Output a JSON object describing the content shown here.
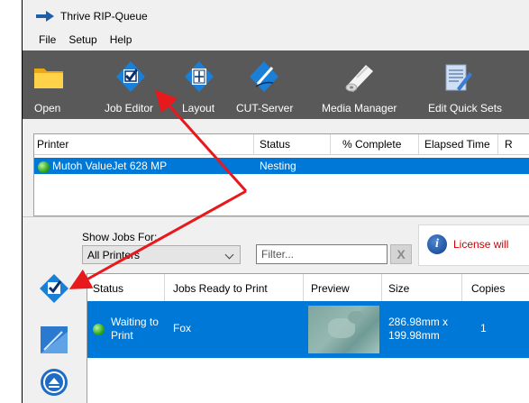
{
  "app": {
    "title": "Thrive RIP-Queue"
  },
  "menu": {
    "items": [
      "File",
      "Setup",
      "Help"
    ]
  },
  "toolbar": {
    "open": "Open",
    "job_editor": "Job Editor",
    "layout": "Layout",
    "cut_server": "CUT-Server",
    "media_manager": "Media Manager",
    "edit_quick_sets": "Edit Quick Sets"
  },
  "printer_table": {
    "columns": [
      "Printer",
      "Status",
      "% Complete",
      "Elapsed Time",
      "R"
    ],
    "rows": [
      {
        "printer": "Mutoh ValueJet 628 MP",
        "status": "Nesting",
        "complete": "",
        "elapsed": ""
      }
    ]
  },
  "filters": {
    "show_jobs_for_label": "Show Jobs For:",
    "show_jobs_for_value": "All Printers",
    "filter_placeholder": "Filter...",
    "clear_label": "X"
  },
  "notice": {
    "text": "License will"
  },
  "jobs_table": {
    "columns": [
      "Status",
      "Jobs Ready to Print",
      "Preview",
      "Size",
      "Copies"
    ],
    "rows": [
      {
        "status_line1": "Waiting to",
        "status_line2": "Print",
        "name": "Fox",
        "size_line1": "286.98mm x",
        "size_line2": "199.98mm",
        "copies": "1"
      }
    ]
  },
  "colors": {
    "toolbar_bg": "#595959",
    "selection": "#0078d7",
    "annotation_arrow": "#e8191d",
    "status_ok": "#2ea51c",
    "license_warning": "#d00000"
  },
  "icons": [
    "app-arrow-icon",
    "folder-icon",
    "job-editor-icon",
    "layout-icon",
    "cut-server-icon",
    "media-manager-icon",
    "edit-quick-sets-icon",
    "status-green-icon",
    "info-icon",
    "chevron-down-icon"
  ]
}
